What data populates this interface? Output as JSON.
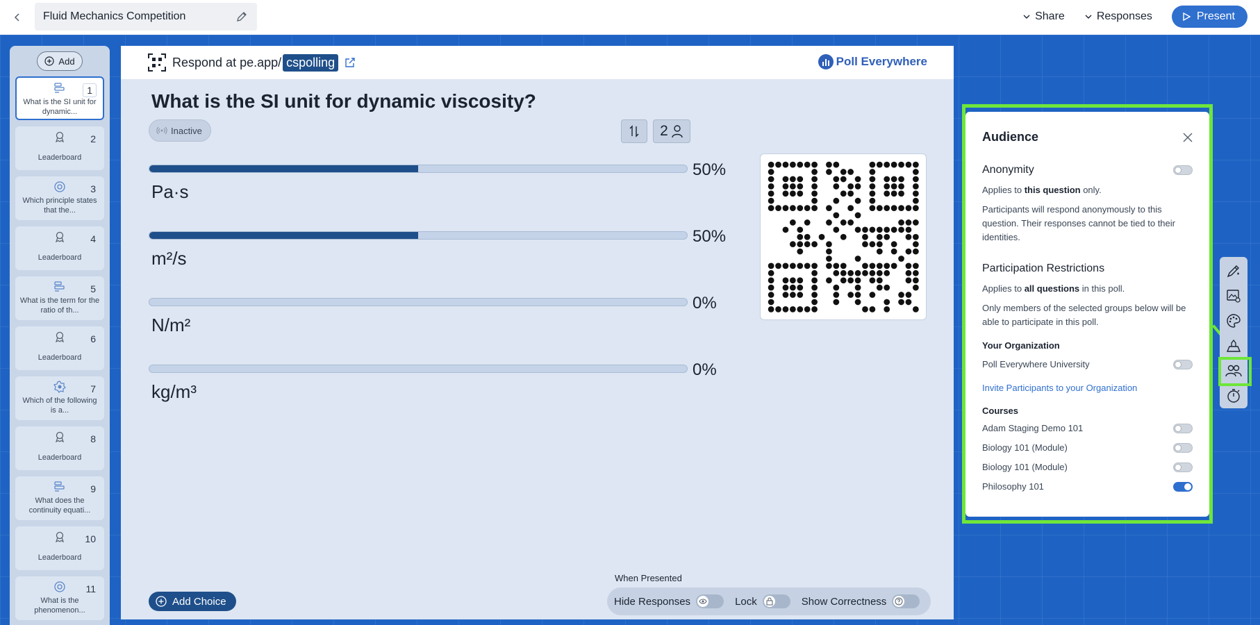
{
  "topbar": {
    "title": "Fluid Mechanics Competition",
    "share_label": "Share",
    "responses_label": "Responses",
    "present_label": "Present"
  },
  "sidebar": {
    "add_label": "Add",
    "slides": [
      {
        "num": "1",
        "label": "What is the SI unit for dynamic...",
        "icon": "multiple-choice-icon",
        "active": true
      },
      {
        "num": "2",
        "label": "Leaderboard",
        "icon": "leaderboard-icon"
      },
      {
        "num": "3",
        "label": "Which principle states that the...",
        "icon": "target-icon"
      },
      {
        "num": "4",
        "label": "Leaderboard",
        "icon": "leaderboard-icon"
      },
      {
        "num": "5",
        "label": "What is the term for the ratio of th...",
        "icon": "multiple-choice-icon"
      },
      {
        "num": "6",
        "label": "Leaderboard",
        "icon": "leaderboard-icon"
      },
      {
        "num": "7",
        "label": "Which of the following is a...",
        "icon": "badge-icon"
      },
      {
        "num": "8",
        "label": "Leaderboard",
        "icon": "leaderboard-icon"
      },
      {
        "num": "9",
        "label": "What does the continuity equati...",
        "icon": "multiple-choice-icon"
      },
      {
        "num": "10",
        "label": "Leaderboard",
        "icon": "leaderboard-icon"
      },
      {
        "num": "11",
        "label": "What is the phenomenon...",
        "icon": "target-icon"
      }
    ]
  },
  "canvas": {
    "respond_prefix": "Respond at pe.app/",
    "respond_code": "cspolling",
    "logo_text": "Poll Everywhere",
    "question": "What is the SI unit for dynamic viscosity?",
    "status": "Inactive",
    "participant_count": "2",
    "choices": [
      {
        "label": "Pa·s",
        "percent": "50%",
        "fraction": 0.5
      },
      {
        "label": "m²/s",
        "percent": "50%",
        "fraction": 0.5
      },
      {
        "label": "N/m²",
        "percent": "0%",
        "fraction": 0
      },
      {
        "label": "kg/m³",
        "percent": "0%",
        "fraction": 0
      }
    ],
    "add_choice_label": "Add Choice",
    "when_presented": "When Presented",
    "hide_responses": "Hide Responses",
    "lock": "Lock",
    "show_correctness": "Show Correctness"
  },
  "audience": {
    "title": "Audience",
    "anonymity": {
      "title": "Anonymity",
      "applies_pre": "Applies to ",
      "applies_bold": "this question",
      "applies_post": " only.",
      "desc": "Participants will respond anonymously to this question. Their responses cannot be tied to their identities.",
      "enabled": false
    },
    "restrictions": {
      "title": "Participation Restrictions",
      "applies_pre": "Applies to ",
      "applies_bold": "all questions",
      "applies_post": " in this poll.",
      "desc": "Only members of the selected groups below will be able to participate in this poll."
    },
    "your_org": {
      "title": "Your Organization",
      "org_name": "Poll Everywhere University",
      "enabled": false,
      "invite_link": "Invite Participants to your Organization"
    },
    "courses": {
      "title": "Courses",
      "items": [
        {
          "name": "Adam Staging Demo 101",
          "enabled": false
        },
        {
          "name": "Biology 101 (Module)",
          "enabled": false
        },
        {
          "name": "Biology 101 (Module)",
          "enabled": false
        },
        {
          "name": "Philosophy 101",
          "enabled": true
        }
      ]
    }
  },
  "colors": {
    "accent": "#2f6fce",
    "bar_fill": "#1f4f8a",
    "highlight": "#6ee63a"
  }
}
